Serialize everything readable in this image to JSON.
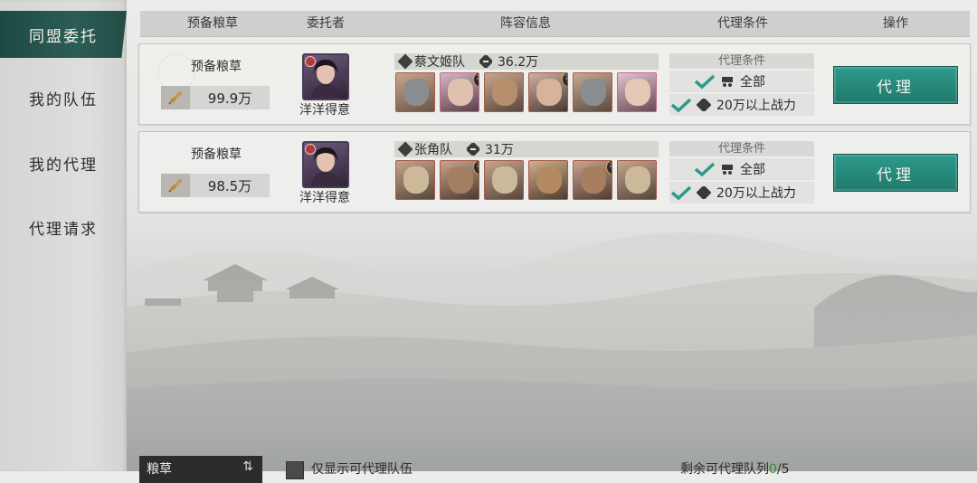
{
  "sidebar": {
    "items": [
      {
        "label": "同盟委托",
        "active": true
      },
      {
        "label": "我的队伍",
        "active": false
      },
      {
        "label": "我的代理",
        "active": false
      },
      {
        "label": "代理请求",
        "active": false
      }
    ]
  },
  "table": {
    "headers": [
      "预备粮草",
      "委托者",
      "阵容信息",
      "代理条件",
      "操作"
    ],
    "rows": [
      {
        "grain_label": "预备粮草",
        "grain_value": "99.9万",
        "delegator": "洋洋得意",
        "team_name": "蔡文姬队",
        "team_power": "36.2万",
        "cond_title": "代理条件",
        "cond_1": "全部",
        "cond_2": "20万以上战力",
        "action": "代理"
      },
      {
        "grain_label": "预备粮草",
        "grain_value": "98.5万",
        "delegator": "洋洋得意",
        "team_name": "张角队",
        "team_power": "31万",
        "cond_title": "代理条件",
        "cond_1": "全部",
        "cond_2": "20万以上战力",
        "action": "代理"
      }
    ],
    "hero_badge": "神"
  },
  "footer": {
    "sort_label": "粮草",
    "sort_arrow": "⇅",
    "only_label": "仅显示可代理队伍",
    "remain_label": "剩余可代理队列",
    "remain_used": "0",
    "remain_total": "/5"
  },
  "colors": {
    "accent": "#1f4a44",
    "button": "#2a8c7d",
    "check": "#2e9a8a"
  }
}
